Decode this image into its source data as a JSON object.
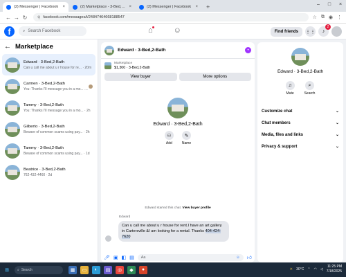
{
  "browser": {
    "tabs": [
      {
        "label": "(2) Messenger | Facebook",
        "active": true
      },
      {
        "label": "(2) Marketplace - 3-Bed,2-Bath",
        "active": false
      },
      {
        "label": "(2) Messenger | Facebook",
        "active": false
      }
    ],
    "url": "facebook.com/messages/t/24847464668188547"
  },
  "header": {
    "search_placeholder": "Search Facebook",
    "find_friends": "Find friends",
    "notification_count": "2"
  },
  "sidebar": {
    "title": "Marketplace",
    "conversations": [
      {
        "name": "Edward · 3-Bed,2-Bath",
        "preview": "Can u call me about u r house for re... · 20m",
        "selected": true
      },
      {
        "name": "Carmen · 3-Bed,2-Bath",
        "preview": "You: Thanks I'll message you in a mo... · 2h",
        "selected": false
      },
      {
        "name": "Tammy · 3-Bed,2-Bath",
        "preview": "You: Thanks I'll message you in a mo... · 2h",
        "selected": false
      },
      {
        "name": "Gilberto · 3-Bed,2-Bath",
        "preview": "Beware of common scams using pay... · 2h",
        "selected": false
      },
      {
        "name": "Tammy · 3-Bed,2-Bath",
        "preview": "Beware of common scams using pay... · 1d",
        "selected": false
      },
      {
        "name": "Beatrice · 3-Bed,2-Bath",
        "preview": "762-432-4460 · 2d",
        "selected": false
      }
    ]
  },
  "chat": {
    "title": "Edward · 3-Bed,2-Bath",
    "listing_source": "Marketplace",
    "listing_price": "$1,300 · 3-Bed,2-Bath",
    "view_buyer": "View buyer",
    "more_options": "More options",
    "profile_name": "Edward · 3-Bed,2-Bath",
    "add_label": "Add",
    "name_label": "Name",
    "started_text": "Edward started this chat.",
    "view_profile": "View buyer profile",
    "sender": "Edward",
    "message_main": "Can u call me about  u r house for rent.I have an art gallery in Cartersville &I am looking for a rental. Thanks ",
    "message_phone": "404-424-7620",
    "composer_placeholder": "Aa"
  },
  "details": {
    "name": "Edward · 3-Bed,2-Bath",
    "mute": "Mute",
    "search": "Search",
    "sections": [
      "Customize chat",
      "Chat members",
      "Media, files and links",
      "Privacy & support"
    ]
  },
  "taskbar": {
    "search_placeholder": "Search",
    "weather": "30°C",
    "time": "11:25 PM",
    "date": "7/18/2025"
  }
}
